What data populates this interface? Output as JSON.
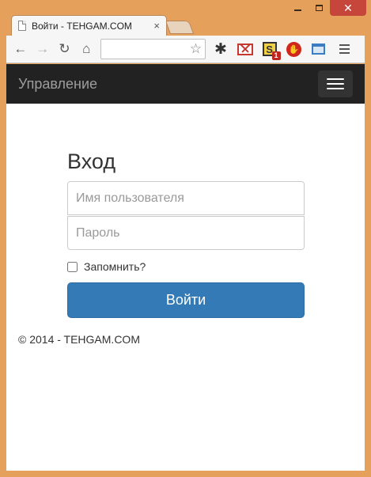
{
  "window": {
    "minimize_label": "",
    "maximize_label": "",
    "close_label": "✕"
  },
  "tab": {
    "title": "Войти - TEHGAM.COM",
    "close_glyph": "×"
  },
  "toolbar": {
    "back_glyph": "←",
    "forward_glyph": "→",
    "reload_glyph": "↻",
    "home_glyph": "⌂",
    "address_value": "",
    "star_glyph": "☆",
    "gear_glyph": "✱",
    "ext_s_letter": "S",
    "ext_s_badge": "1",
    "ext_stop_glyph": "✋"
  },
  "navbar": {
    "brand": "Управление"
  },
  "login": {
    "heading": "Вход",
    "username_placeholder": "Имя пользователя",
    "password_placeholder": "Пароль",
    "remember_label": "Запомнить?",
    "submit_label": "Войти"
  },
  "footer": {
    "text": "© 2014 - TEHGAM.COM"
  },
  "colors": {
    "window_frame": "#e5a15b",
    "navbar_bg": "#222222",
    "primary_button": "#337ab7",
    "close_button": "#c7463b"
  },
  "icons": [
    "page-icon",
    "back-icon",
    "forward-icon",
    "reload-icon",
    "home-icon",
    "star-icon",
    "gear-icon",
    "gmail-icon",
    "s-extension-icon",
    "stop-icon",
    "window-icon",
    "menu-icon",
    "hamburger-icon"
  ]
}
